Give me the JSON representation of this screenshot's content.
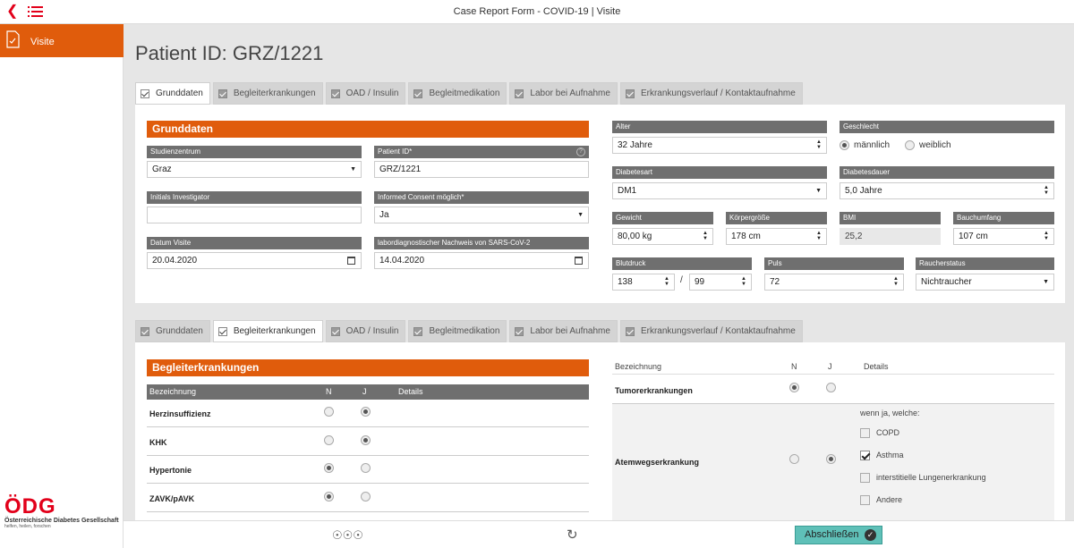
{
  "topbar": {
    "title": "Case Report Form - COVID-19 | Visite",
    "back_icon": "chevron-left-icon",
    "menu_icon": "list-icon"
  },
  "sidebar": {
    "nav_label": "Visite",
    "nav_icon": "document-check-icon",
    "logo_big": "ÖDG",
    "logo_org": "Österreichische Diabetes Gesellschaft",
    "logo_tag": "helfen, heilen, forschen"
  },
  "page": {
    "title": "Patient ID: GRZ/1221"
  },
  "tabs": [
    "Grunddaten",
    "Begleiterkrankungen",
    "OAD / Insulin",
    "Begleitmedikation",
    "Labor bei Aufnahme",
    "Erkrankungsverlauf / Kontaktaufnahme"
  ],
  "grund": {
    "heading": "Grunddaten",
    "studienzentrum": {
      "label": "Studienzentrum",
      "value": "Graz"
    },
    "patient_id": {
      "label": "Patient ID*",
      "value": "GRZ/1221",
      "help": "?"
    },
    "initials": {
      "label": "Initials Investigator",
      "value": ""
    },
    "consent": {
      "label": "Informed Consent möglich*",
      "value": "Ja"
    },
    "datum": {
      "label": "Datum Visite",
      "value": "20.04.2020"
    },
    "labor": {
      "label": "labordiagnostischer Nachweis von SARS-CoV-2",
      "value": "14.04.2020"
    },
    "alter": {
      "label": "Alter",
      "value": "32 Jahre"
    },
    "geschlecht": {
      "label": "Geschlecht",
      "male": "männlich",
      "female": "weiblich",
      "selected": "männlich"
    },
    "diabetesart": {
      "label": "Diabetesart",
      "value": "DM1"
    },
    "diabetesdauer": {
      "label": "Diabetesdauer",
      "value": "5,0 Jahre"
    },
    "gewicht": {
      "label": "Gewicht",
      "value": "80,00 kg"
    },
    "groesse": {
      "label": "Körpergröße",
      "value": "178 cm"
    },
    "bmi": {
      "label": "BMI",
      "value": "25,2"
    },
    "bauch": {
      "label": "Bauchumfang",
      "value": "107 cm"
    },
    "blutdruck": {
      "label": "Blutdruck",
      "sys": "138",
      "sep": "/",
      "dia": "99"
    },
    "puls": {
      "label": "Puls",
      "value": "72"
    },
    "raucher": {
      "label": "Raucherstatus",
      "value": "Nichtraucher"
    }
  },
  "begleit": {
    "heading": "Begleiterkrankungen",
    "cols": {
      "name": "Bezeichnung",
      "n": "N",
      "j": "J",
      "details": "Details"
    },
    "left_rows": [
      {
        "name": "Herzinsuffizienz",
        "sel": "J"
      },
      {
        "name": "KHK",
        "sel": "J"
      },
      {
        "name": "Hypertonie",
        "sel": "N"
      },
      {
        "name": "ZAVK/pAVK",
        "sel": "N"
      }
    ],
    "right_rows": [
      {
        "name": "Tumorerkrankungen",
        "sel": "N"
      },
      {
        "name": "Atemwegserkrankung",
        "sel": "J"
      }
    ],
    "details_prompt": "wenn ja, welche:",
    "options": [
      {
        "label": "COPD",
        "checked": false
      },
      {
        "label": "Asthma",
        "checked": true
      },
      {
        "label": "interstitielle Lungenerkrankung",
        "checked": false
      },
      {
        "label": "Andere",
        "checked": false
      }
    ]
  },
  "bottom": {
    "finish_label": "Abschließen",
    "icons": [
      "group-icon",
      "refresh-icon"
    ]
  }
}
